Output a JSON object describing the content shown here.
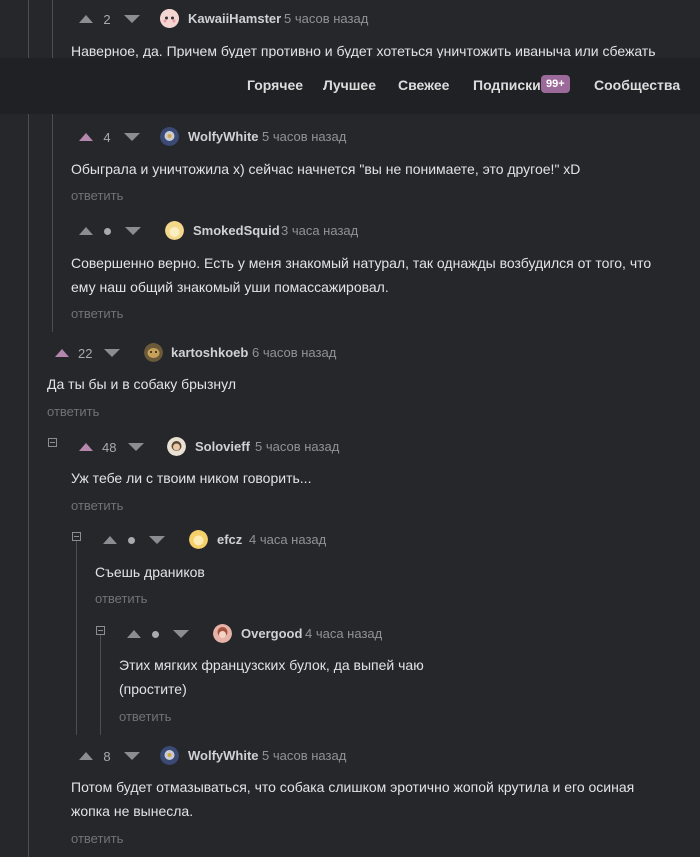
{
  "nav": {
    "items": [
      "Горячее",
      "Лучшее",
      "Свежее",
      "Подписки",
      "Сообщества"
    ],
    "subscriptions_badge": "99+"
  },
  "reply_label": "ответить",
  "comments": [
    {
      "author": "KawaiiHamster",
      "time": "5 часов назад",
      "score": "2",
      "text": [
        "Наверное, да. Причем будет противно и будет хотеться уничтожить иваныча или сбежать"
      ]
    },
    {
      "author": "WolfyWhite",
      "time": "5 часов назад",
      "score": "4",
      "text": [
        "Обыграла и уничтожила x) сейчас начнется \"вы не понимаете, это другое!\" xD"
      ]
    },
    {
      "author": "SmokedSquid",
      "time": "3 часа назад",
      "score": "",
      "text": [
        "Совершенно верно. Есть у меня знакомый натурал, так однажды возбудился от того, что",
        "ему наш общий знакомый уши помассажировал."
      ]
    },
    {
      "author": "kartoshkoeb",
      "time": "6 часов назад",
      "score": "22",
      "text": [
        "Да ты бы и в собаку брызнул"
      ]
    },
    {
      "author": "Solovieff",
      "time": "5 часов назад",
      "score": "48",
      "text": [
        "Уж тебе ли с твоим ником говорить..."
      ]
    },
    {
      "author": "efcz",
      "time": "4 часа назад",
      "score": "",
      "text": [
        "Съешь драников"
      ]
    },
    {
      "author": "Overgood",
      "time": "4 часа назад",
      "score": "",
      "text": [
        "Этих мягких французских булок, да выпей чаю",
        "(простите)"
      ]
    },
    {
      "author": "WolfyWhite",
      "time": "5 часов назад",
      "score": "8",
      "text": [
        "Потом будет отмазываться, что собака слишком эротично жопой крутила и его осиная",
        "жопка не вынесла."
      ]
    }
  ],
  "colors": {
    "background": "#25272b",
    "upvote_active": "#b487ad",
    "badge": "#9b6a9a"
  }
}
